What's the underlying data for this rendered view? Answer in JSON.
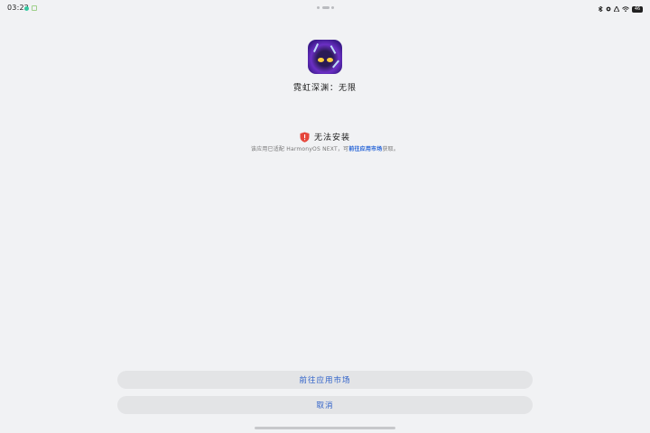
{
  "status_bar": {
    "time": "03:22",
    "battery": "46",
    "icons": [
      "bluetooth-icon",
      "signal-icon",
      "network-icon",
      "wifi-icon",
      "battery-icon"
    ]
  },
  "app": {
    "name": "霓虹深渊：无限",
    "icon": "game-app-icon"
  },
  "warning": {
    "title": "无法安装",
    "desc_before": "该应用已适配 HarmonyOS NEXT，可",
    "desc_link": "前往应用市场",
    "desc_after": "获取。",
    "icon_color": "#e5463b"
  },
  "actions": {
    "store_label": "前往应用市场",
    "cancel_label": "取消",
    "accent": "#2f61c9"
  }
}
